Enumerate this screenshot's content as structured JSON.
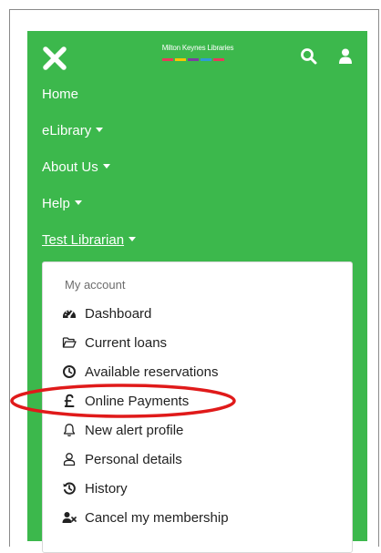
{
  "header": {
    "logo_text": "Milton Keynes Libraries",
    "logo_stripe_colors": [
      "#e63b5a",
      "#f7c600",
      "#7b3fa0",
      "#2f9ad6",
      "#e63b5a"
    ],
    "icons": [
      "close-icon",
      "search-icon",
      "user-icon"
    ]
  },
  "nav": {
    "home": "Home",
    "elibrary": "eLibrary",
    "about": "About Us",
    "help": "Help",
    "user": "Test Librarian"
  },
  "account_menu": {
    "heading": "My account",
    "items": [
      {
        "label": "Dashboard",
        "icon": "dashboard-icon"
      },
      {
        "label": "Current loans",
        "icon": "folder-open-icon"
      },
      {
        "label": "Available reservations",
        "icon": "clock-icon"
      },
      {
        "label": "Online Payments",
        "icon": "pound-icon"
      },
      {
        "label": "New alert profile",
        "icon": "bell-icon"
      },
      {
        "label": "Personal details",
        "icon": "person-icon"
      },
      {
        "label": "History",
        "icon": "history-icon"
      },
      {
        "label": "Cancel my membership",
        "icon": "user-remove-icon"
      }
    ]
  },
  "colors": {
    "brand_green": "#3cb84c",
    "annotation_red": "#e01a1a"
  }
}
